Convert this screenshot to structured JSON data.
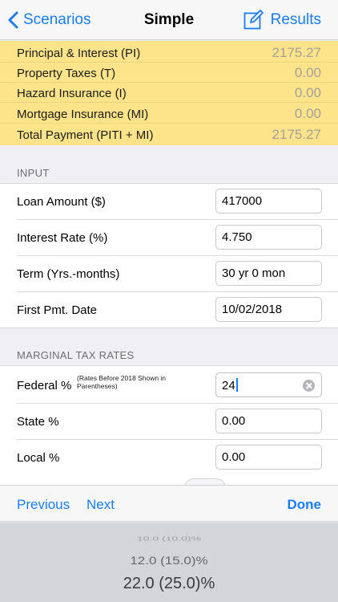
{
  "nav": {
    "back_label": "Scenarios",
    "title": "Simple",
    "results_label": "Results",
    "compose_icon": "compose-icon"
  },
  "summary": [
    {
      "label": "Principal & Interest (PI)",
      "value": "2175.27"
    },
    {
      "label": "Property Taxes (T)",
      "value": "0.00"
    },
    {
      "label": "Hazard Insurance (I)",
      "value": "0.00"
    },
    {
      "label": "Mortgage Insurance (MI)",
      "value": "0.00"
    },
    {
      "label": "Total Payment (PITI + MI)",
      "value": "2175.27"
    }
  ],
  "input_section": {
    "header": "INPUT",
    "fields": [
      {
        "label": "Loan Amount ($)",
        "value": "417000"
      },
      {
        "label": "Interest Rate (%)",
        "value": "4.750"
      },
      {
        "label": "Term (Yrs.-months)",
        "value": "30 yr 0 mon"
      },
      {
        "label": "First Pmt. Date",
        "value": "10/02/2018"
      }
    ]
  },
  "tax_section": {
    "header": "MARGINAL TAX RATES",
    "fields": [
      {
        "label": "Federal %",
        "note": "(Rates Before 2018 Shown in Parentheses)",
        "value": "24"
      },
      {
        "label": "State %",
        "value": "0.00"
      },
      {
        "label": "Local %",
        "value": "0.00"
      }
    ]
  },
  "toolbar": {
    "previous_label": "Previous",
    "next_label": "Next",
    "done_label": "Done"
  },
  "picker": {
    "options": [
      "10.0 (10.0)%",
      "12.0 (15.0)%",
      "22.0 (25.0)%"
    ]
  },
  "colors": {
    "accent": "#1a7cf5",
    "summary_bg": "#fde389",
    "summary_value": "#a5a09a"
  }
}
